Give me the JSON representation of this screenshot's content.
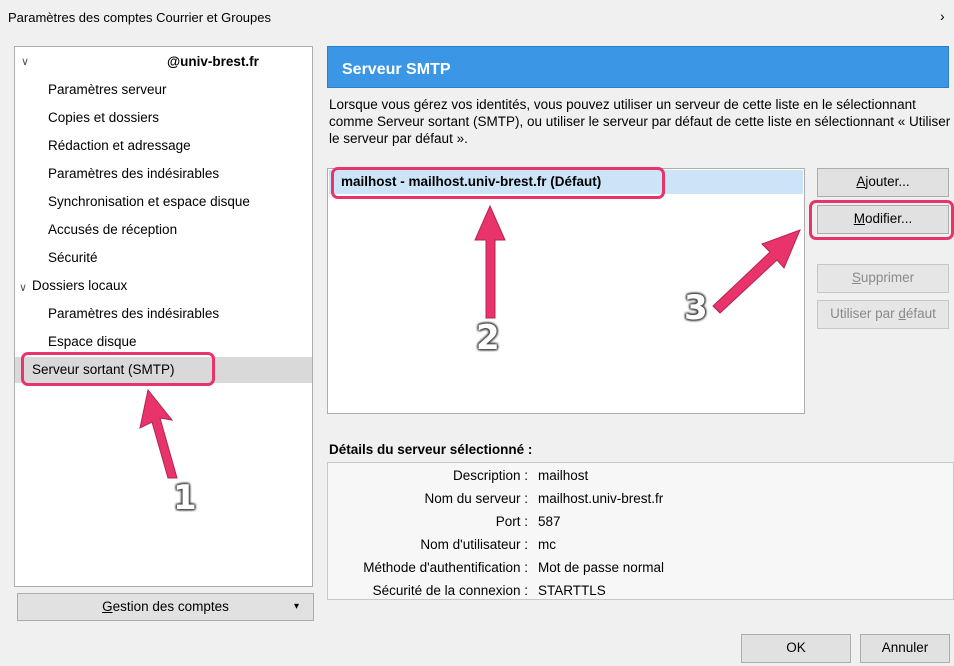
{
  "window": {
    "title": "Paramètres des comptes Courrier et Groupes",
    "close_glyph": "›"
  },
  "tree": {
    "account": "@univ-brest.fr",
    "account_items": [
      "Paramètres serveur",
      "Copies et dossiers",
      "Rédaction et adressage",
      "Paramètres des indésirables",
      "Synchronisation et espace disque",
      "Accusés de réception",
      "Sécurité"
    ],
    "local_folders": "Dossiers locaux",
    "local_items": [
      "Paramètres des indésirables",
      "Espace disque"
    ],
    "smtp_item": "Serveur sortant (SMTP)"
  },
  "account_actions": {
    "label_pre": "",
    "label_u": "G",
    "label_post": "estion des comptes",
    "arrow": "▾"
  },
  "panel": {
    "heading": "Serveur SMTP",
    "description": "Lorsque vous gérez vos identités, vous pouvez utiliser un serveur de cette liste en le sélectionnant comme Serveur sortant (SMTP), ou utiliser le serveur par défaut de cette liste en sélectionnant « Utiliser le serveur par défaut ».",
    "servers": [
      "mailhost - mailhost.univ-brest.fr (Défaut)"
    ],
    "buttons": {
      "add": {
        "u": "A",
        "rest": "jouter..."
      },
      "edit": {
        "u": "M",
        "rest": "odifier..."
      },
      "delete": {
        "u": "S",
        "rest": "upprimer"
      },
      "default_pre": "Utiliser par ",
      "default_u": "d",
      "default_post": "éfaut"
    },
    "details_title": "Détails du serveur sélectionné :",
    "details": [
      {
        "label": "Description :",
        "value": "mailhost"
      },
      {
        "label": "Nom du serveur :",
        "value": "mailhost.univ-brest.fr"
      },
      {
        "label": "Port :",
        "value": "587"
      },
      {
        "label": "Nom d'utilisateur :",
        "value": "mc"
      },
      {
        "label": "Méthode d'authentification :",
        "value": "Mot de passe normal"
      },
      {
        "label": "Sécurité de la connexion :",
        "value": "STARTTLS"
      }
    ]
  },
  "footer": {
    "ok": "OK",
    "cancel": "Annuler"
  },
  "annotations": {
    "step1": "1",
    "step2": "2",
    "step3": "3",
    "color": "#e8336b"
  }
}
